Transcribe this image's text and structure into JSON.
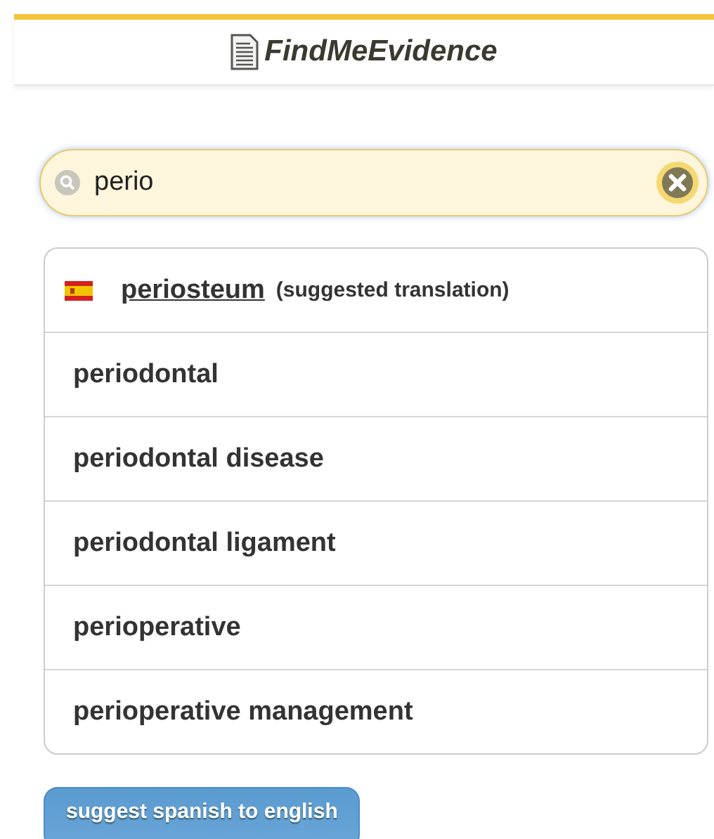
{
  "header": {
    "title": "FindMeEvidence"
  },
  "search": {
    "value": "perio"
  },
  "suggestions": [
    {
      "kind": "translation",
      "text": "periosteum",
      "note": "(suggested translation)"
    },
    {
      "kind": "term",
      "text": "periodontal"
    },
    {
      "kind": "term",
      "text": "periodontal disease"
    },
    {
      "kind": "term",
      "text": "periodontal ligament"
    },
    {
      "kind": "term",
      "text": "perioperative"
    },
    {
      "kind": "term",
      "text": "perioperative management"
    }
  ],
  "button": {
    "label": "suggest spanish to english"
  }
}
